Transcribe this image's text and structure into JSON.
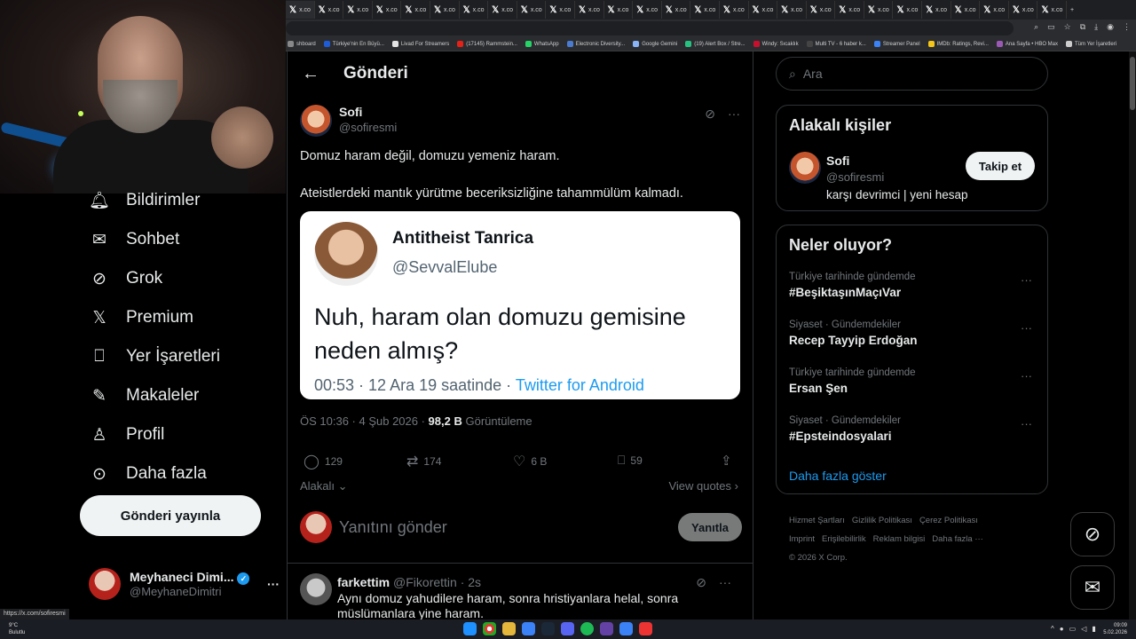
{
  "browser": {
    "tab_label": "x.co",
    "tab_count": 27,
    "bookmarks": [
      {
        "label": "shboard",
        "color": "#888888"
      },
      {
        "label": "Türkiye'nin En Büyü...",
        "color": "#1e5bd6"
      },
      {
        "label": "Livad For Streamers",
        "color": "#e4e4e4"
      },
      {
        "label": "(17145) Rammstein...",
        "color": "#e62117"
      },
      {
        "label": "WhatsApp",
        "color": "#25d366"
      },
      {
        "label": "Electronic Diversity...",
        "color": "#4a7bd0"
      },
      {
        "label": "Google Gemini",
        "color": "#8ab4f8"
      },
      {
        "label": "(19) Alert Box / Stre...",
        "color": "#26c281"
      },
      {
        "label": "Windy: Sıcaklık",
        "color": "#c8102e"
      },
      {
        "label": "Multi TV - 6 haber k...",
        "color": "#444444"
      },
      {
        "label": "Streamer Panel",
        "color": "#3b82f6"
      },
      {
        "label": "IMDb: Ratings, Revi...",
        "color": "#f5c518"
      },
      {
        "label": "Ana Sayfa • HBO Max",
        "color": "#9b59b6"
      },
      {
        "label": "Tüm Yer İşaretleri",
        "color": "#cccccc"
      }
    ],
    "status_url": "https://x.com/sofiresmi"
  },
  "nav": {
    "items": [
      {
        "label": "Bildirimler",
        "icon": "bell-icon"
      },
      {
        "label": "Sohbet",
        "icon": "mail-icon"
      },
      {
        "label": "Grok",
        "icon": "grok-icon"
      },
      {
        "label": "Premium",
        "icon": "x-logo-icon"
      },
      {
        "label": "Yer İşaretleri",
        "icon": "bookmark-icon"
      },
      {
        "label": "Makaleler",
        "icon": "article-icon"
      },
      {
        "label": "Profil",
        "icon": "person-icon"
      },
      {
        "label": "Daha fazla",
        "icon": "more-circle-icon"
      }
    ],
    "post_button": "Gönderi yayınla",
    "account_name": "Meyhaneci Dimi...",
    "account_handle": "@MeyhaneDimitri",
    "account_more": "···"
  },
  "main": {
    "header_title": "Gönderi",
    "tweet": {
      "author_name": "Sofi",
      "author_handle": "@sofiresmi",
      "text_line1": "Domuz haram değil, domuzu yemeniz haram.",
      "text_line2": "Ateistlerdeki mantık yürütme beceriksizliğine tahammülüm kalmadı.",
      "card": {
        "name": "Antitheist Tanrica",
        "handle": "@SevvalElube",
        "text": "Nuh, haram olan domuzu gemisine neden almış?",
        "footer_time": "00:53 · 12 Ara 19 saatinde · ",
        "footer_source": "Twitter for Android"
      },
      "time": "ÖS 10:36 · 4 Şub 2026 · ",
      "views_value": "98,2 B",
      "views_label": " Görüntüleme",
      "replies": "129",
      "reposts": "174",
      "likes": "6 B",
      "bookmarks": "59"
    },
    "relevance_label": "Alakalı",
    "view_quotes": "View quotes",
    "reply_placeholder": "Yanıtını gönder",
    "reply_button": "Yanıtla",
    "reply2": {
      "name": "farkettim",
      "handle": "@Fikorettin · 2s",
      "text": "Aynı domuz yahudilere haram, sonra hristiyanlara helal, sonra müslümanlara yine haram."
    }
  },
  "right": {
    "search_placeholder": "Ara",
    "related_title": "Alakalı kişiler",
    "related_name": "Sofi",
    "related_handle": "@sofiresmi",
    "related_bio": "karşı devrimci | yeni hesap",
    "follow_button": "Takip et",
    "trends_title": "Neler oluyor?",
    "trends": [
      {
        "context": "Türkiye tarihinde gündemde",
        "title": "#BeşiktaşınMaçıVar"
      },
      {
        "context": "Siyaset · Gündemdekiler",
        "title": "Recep Tayyip Erdoğan"
      },
      {
        "context": "Türkiye tarihinde gündemde",
        "title": "Ersan Şen"
      },
      {
        "context": "Siyaset · Gündemdekiler",
        "title": "#Epsteindosyalari"
      }
    ],
    "show_more": "Daha fazla göster",
    "footer_links": [
      "Hizmet Şartları",
      "Gizlilik Politikası",
      "Çerez Politikası",
      "Imprint",
      "Erişilebilirlik",
      "Reklam bilgisi",
      "Daha fazla ···"
    ],
    "copyright": "© 2026 X Corp."
  },
  "taskbar": {
    "temp": "9°C",
    "weather": "Bulutlu",
    "time": "09:09",
    "date": "5.02.2026"
  }
}
